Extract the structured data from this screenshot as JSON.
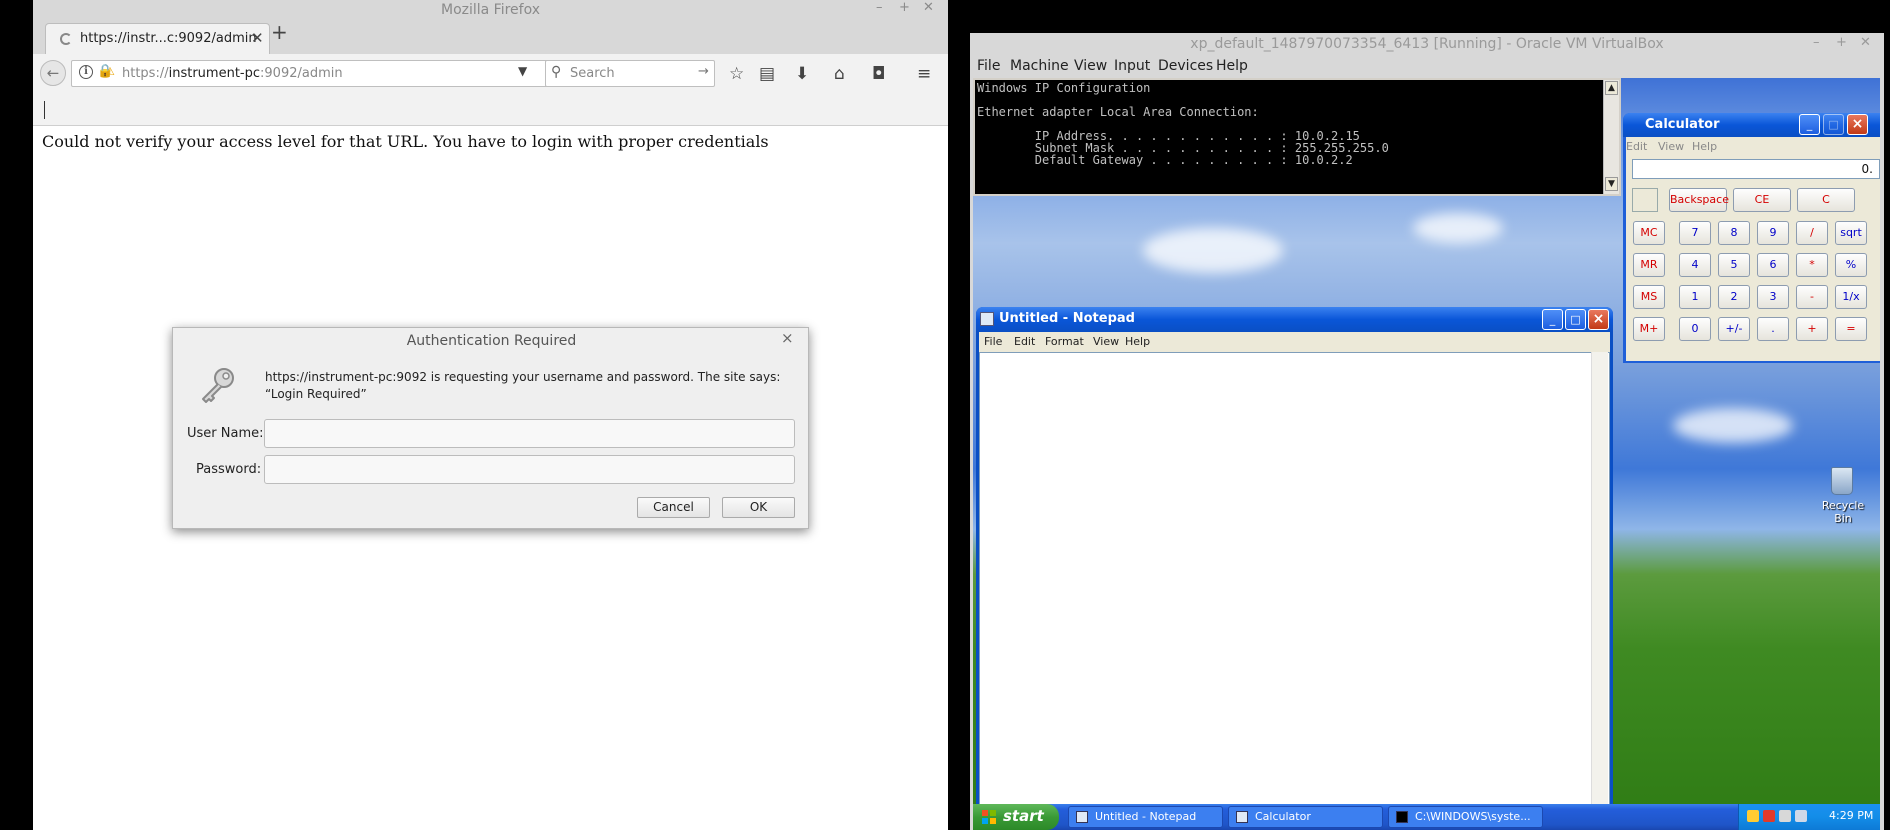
{
  "firefox": {
    "window_title": "Mozilla Firefox",
    "tab_title": "https://instr...c:9092/admin",
    "url_prefix": "https://",
    "url_host": "instrument-pc",
    "url_rest": ":9092/admin",
    "search_placeholder": "Search",
    "page_message": "Could not verify your access level for that URL. You have to login with proper credentials"
  },
  "auth_dialog": {
    "title": "Authentication Required",
    "message": "https://instrument-pc:9092 is requesting your username and password. The site says: “Login Required”",
    "username_label": "User Name:",
    "password_label": "Password:",
    "username_value": "",
    "password_value": "",
    "cancel_label": "Cancel",
    "ok_label": "OK"
  },
  "virtualbox": {
    "window_title": "xp_default_1487970073354_6413 [Running] - Oracle VM VirtualBox",
    "menu": [
      "File",
      "Machine",
      "View",
      "Input",
      "Devices",
      "Help"
    ]
  },
  "cmd": {
    "lines": [
      "Windows IP Configuration",
      "",
      "Ethernet adapter Local Area Connection:",
      "",
      "        IP Address. . . . . . . . . . . . : 10.0.2.15",
      "        Subnet Mask . . . . . . . . . . . : 255.255.255.0",
      "        Default Gateway . . . . . . . . . : 10.0.2.2"
    ]
  },
  "calculator": {
    "title": "Calculator",
    "menu": [
      "Edit",
      "View",
      "Help"
    ],
    "display": "0.",
    "top_keys": [
      "Backspace",
      "CE",
      "C"
    ],
    "memory_keys": [
      "MC",
      "MR",
      "MS",
      "M+"
    ],
    "rows": [
      [
        "7",
        "8",
        "9",
        "/",
        "sqrt"
      ],
      [
        "4",
        "5",
        "6",
        "*",
        "%"
      ],
      [
        "1",
        "2",
        "3",
        "-",
        "1/x"
      ],
      [
        "0",
        "+/-",
        ".",
        "+",
        "="
      ]
    ],
    "colors": {
      "red": "#d40000",
      "blue": "#0000c8"
    }
  },
  "notepad": {
    "title": "Untitled - Notepad",
    "menu": [
      "File",
      "Edit",
      "Format",
      "View",
      "Help"
    ],
    "text": ""
  },
  "taskbar": {
    "start_label": "start",
    "buttons": [
      "Untitled - Notepad",
      "Calculator",
      "C:\\WINDOWS\\syste..."
    ],
    "clock": "4:29 PM"
  },
  "desktop": {
    "recycle_bin_label": "Recycle Bin"
  }
}
